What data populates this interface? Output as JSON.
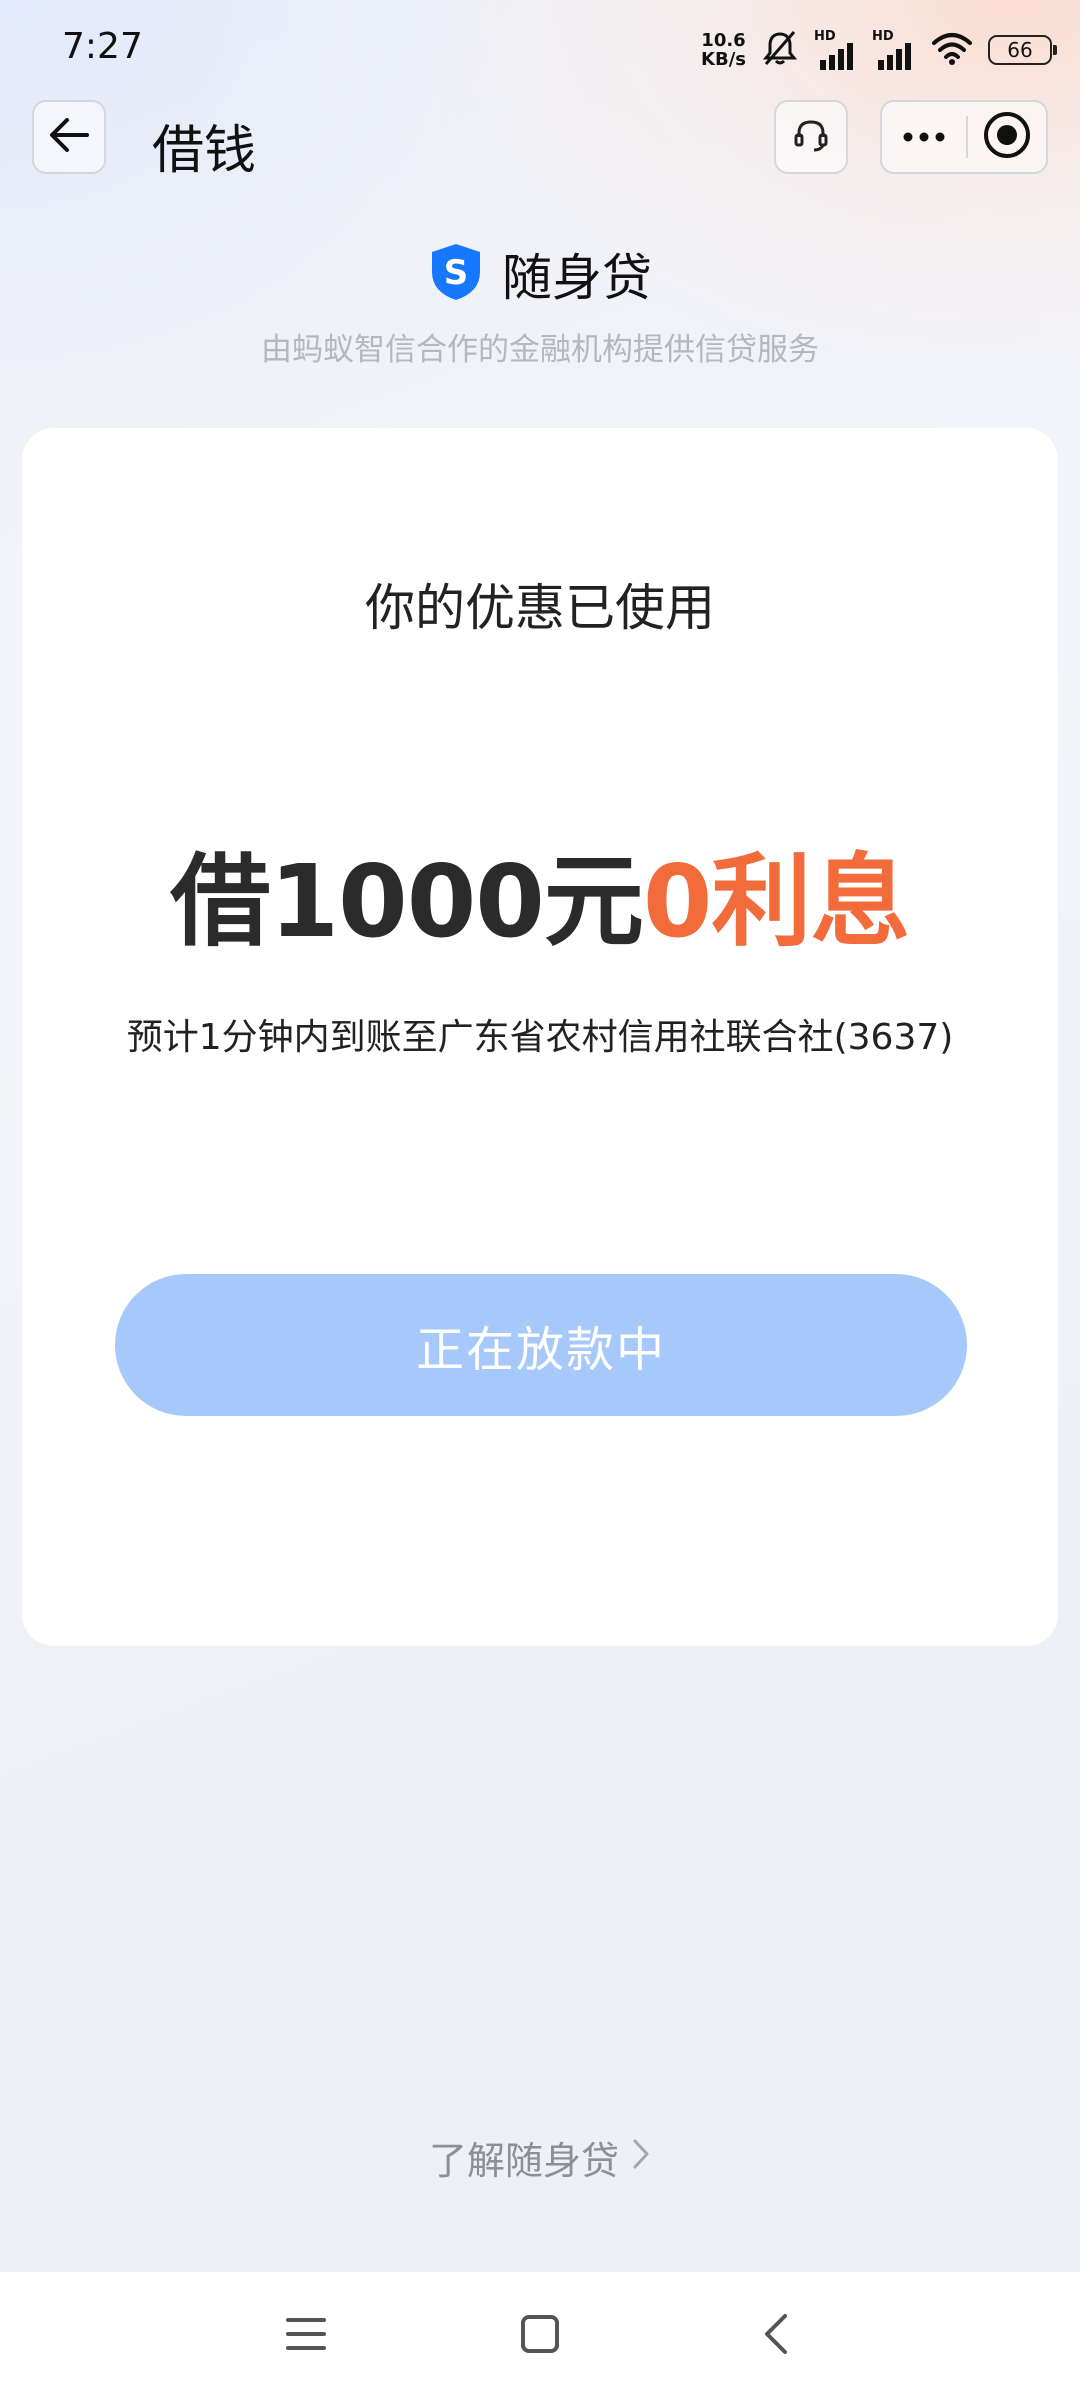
{
  "status_bar": {
    "time": "7:27",
    "net_speed_value": "10.6",
    "net_speed_unit": "KB/s",
    "sim1_label": "HD",
    "sim2_label": "HD",
    "battery": "66"
  },
  "nav": {
    "title": "借钱"
  },
  "brand": {
    "name": "随身贷",
    "logo_letter": "S",
    "subtitle": "由蚂蚁智信合作的金融机构提供信贷服务",
    "color": "#1677ff"
  },
  "card": {
    "heading": "你的优惠已使用",
    "amount_text": "借1000元",
    "highlight_text": "0利息",
    "arrival_note": "预计1分钟内到账至广东省农村信用社联合社(3637)",
    "button_label": "正在放款中"
  },
  "footer": {
    "learn_more": "了解随身贷"
  },
  "colors": {
    "highlight": "#f26b3a",
    "button_bg": "#a6c8fb"
  },
  "icons": {
    "back": "arrow-left-icon",
    "service": "headset-icon",
    "more": "more-dots-icon",
    "close": "record-circle-icon",
    "learn_more": "chevron-right-icon",
    "sys_menu": "menu-lines-icon",
    "sys_home": "square-home-icon",
    "sys_back": "chevron-left-icon"
  }
}
